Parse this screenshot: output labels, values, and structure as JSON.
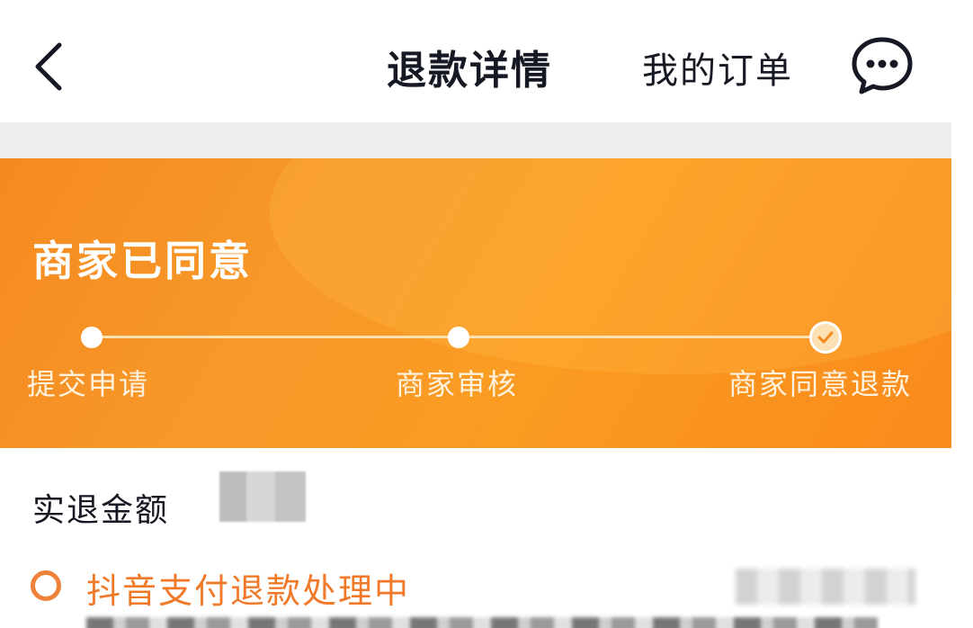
{
  "nav": {
    "title": "退款详情",
    "my_orders_label": "我的订单"
  },
  "status_banner": {
    "title": "商家已同意",
    "steps": [
      {
        "label": "提交申请",
        "state": "passed"
      },
      {
        "label": "商家审核",
        "state": "passed"
      },
      {
        "label": "商家同意退款",
        "state": "current"
      }
    ]
  },
  "refund": {
    "amount_label": "实退金额"
  },
  "payment_status": {
    "text": "抖音支付退款处理中"
  },
  "colors": {
    "accent_orange": "#f98e1f",
    "status_orange": "#f07a2a"
  }
}
